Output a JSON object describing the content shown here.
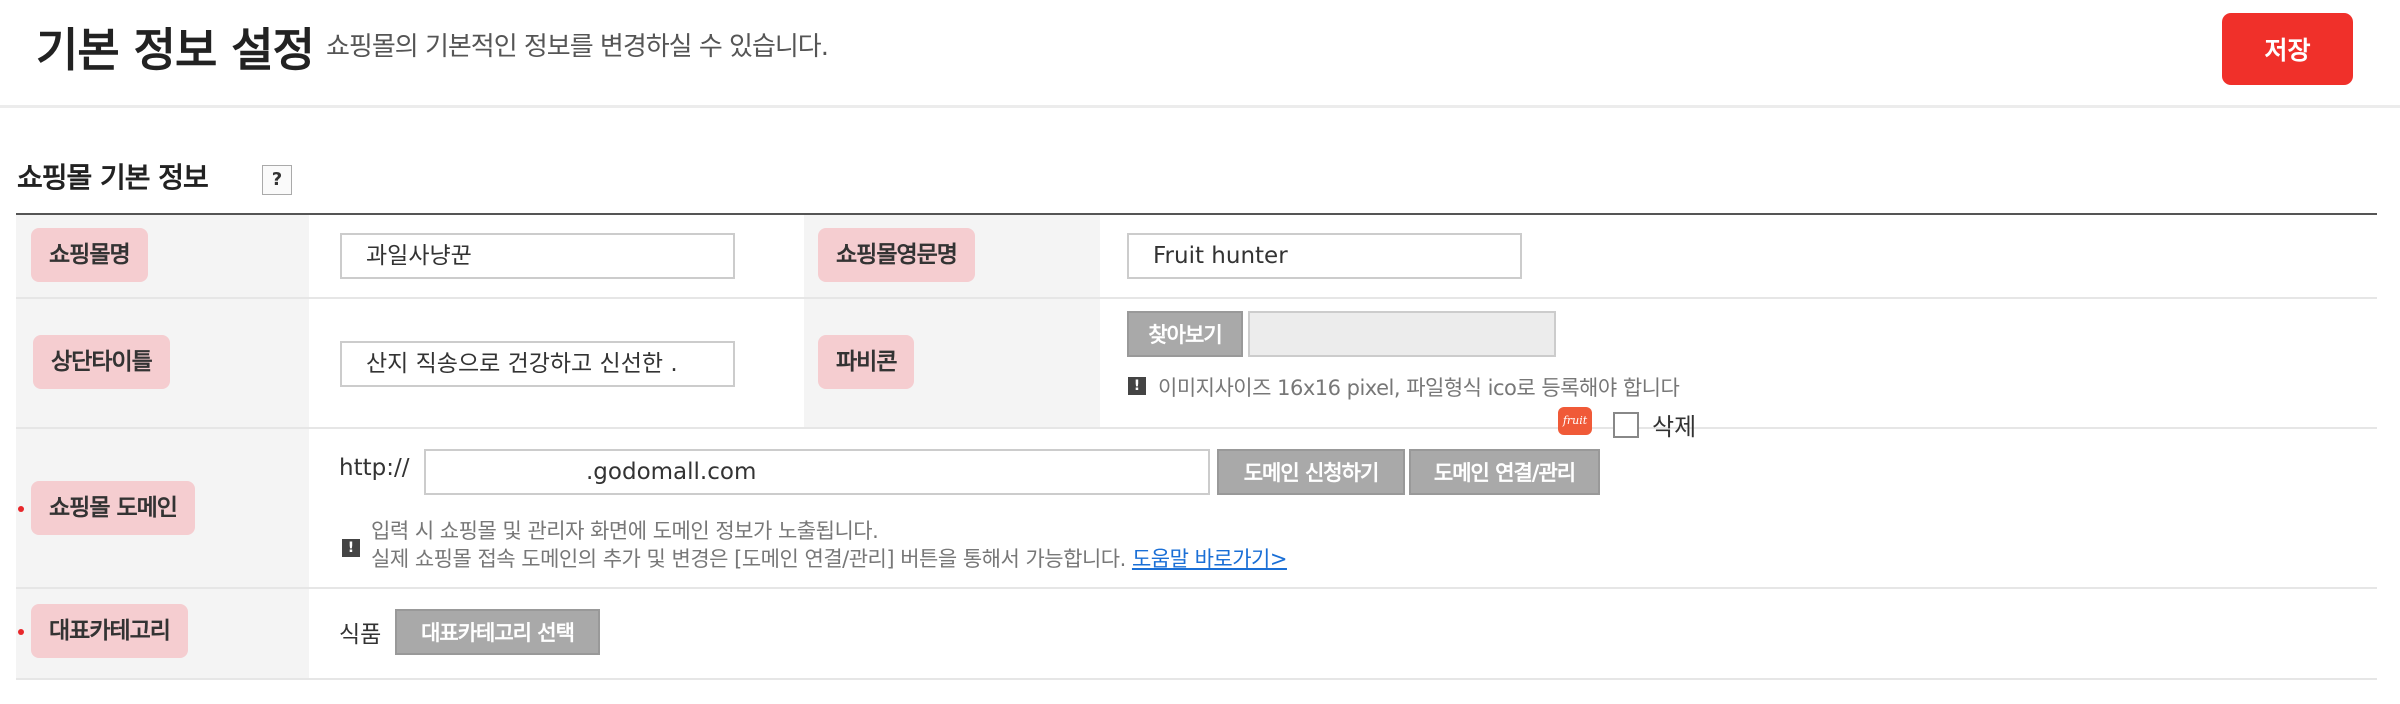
{
  "header": {
    "title": "기본 정보 설정",
    "subtitle": "쇼핑몰의 기본적인 정보를 변경하실 수 있습니다.",
    "save_label": "저장"
  },
  "section": {
    "title": "쇼핑몰 기본 정보",
    "help_label": "?"
  },
  "fields": {
    "mall_name": {
      "label": "쇼핑몰명",
      "value": "과일사냥꾼"
    },
    "mall_name_en": {
      "label": "쇼핑몰영문명",
      "value": "Fruit hunter"
    },
    "top_title": {
      "label": "상단타이틀",
      "value": "산지 직송으로 건강하고 신선한 ."
    },
    "favicon": {
      "label": "파비콘",
      "browse_label": "찾아보기",
      "thumb_text": "fruit",
      "delete_label": "삭제",
      "notice": "이미지사이즈 16x16 pixel, 파일형식 ico로 등록해야 합니다"
    },
    "domain": {
      "label": "쇼핑몰 도메인",
      "prefix": "http://",
      "value": ".godomall.com",
      "apply_label": "도메인 신청하기",
      "manage_label": "도메인 연결/관리",
      "notice_line1": "입력 시 쇼핑몰 및 관리자 화면에 도메인 정보가 노출됩니다.",
      "notice_line2": "실제 쇼핑몰 접속 도메인의 추가 및 변경은 [도메인 연결/관리] 버튼을 통해서 가능합니다.",
      "help_link": "도움말 바로가기>"
    },
    "category": {
      "label": "대표카테고리",
      "value": "식품",
      "select_label": "대표카테고리 선택"
    }
  },
  "icons": {
    "notice": "exclamation-icon",
    "help": "question-icon"
  },
  "colors": {
    "accent": "#f0302a",
    "label_bg": "#f5cdd0",
    "required_dot": "#e8272b",
    "link": "#1a6fd6"
  }
}
